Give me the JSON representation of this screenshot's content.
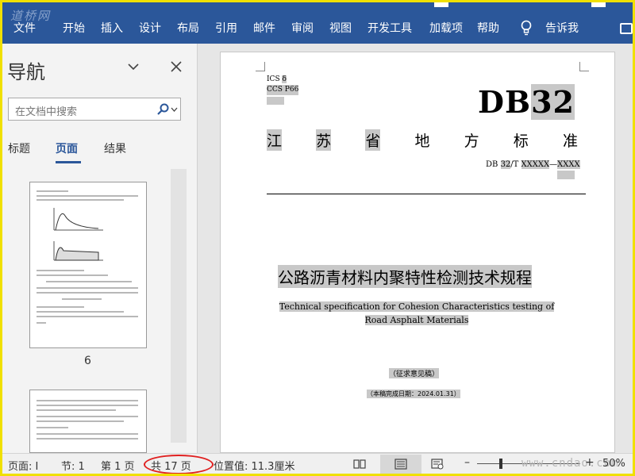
{
  "ribbon": {
    "watermark": "道桥网",
    "tabs": [
      "文件",
      "开始",
      "插入",
      "设计",
      "布局",
      "引用",
      "邮件",
      "审阅",
      "视图",
      "开发工具",
      "加载项",
      "帮助"
    ],
    "tell_me": "告诉我",
    "accent": "#2b579a"
  },
  "nav": {
    "title": "导航",
    "search_placeholder": "在文档中搜索",
    "tabs": [
      "标题",
      "页面",
      "结果"
    ],
    "active_tab": "页面",
    "thumb_page_number": "6"
  },
  "document": {
    "ics": "ICS",
    "ics_no": "δ",
    "ccs": "CCS P66",
    "db_code": "DB",
    "db_num": "32",
    "province_chars": [
      "江",
      "苏",
      "省",
      "地",
      "方",
      "标",
      "准"
    ],
    "std_prefix": "DB",
    "std_num": "32",
    "std_suffix": "/T",
    "std_no1": "XXXXX",
    "std_dash": "—",
    "std_no2": "XXXX",
    "title_cn": "公路沥青材料内聚特性检测技术规程",
    "title_en": "Technical specification for Cohesion Characteristics testing of Road Asphalt Materials",
    "draft_note": "（征求意见稿）",
    "completion_date": "（本稿完成日期：2024.01.31）"
  },
  "status": {
    "page": "页面: I",
    "section": "节: 1",
    "page_num": "第 1 页",
    "total_pages": "共 17 页",
    "position": "位置值: 11.3厘米",
    "zoom_minus": "–",
    "zoom_plus": "+",
    "zoom": "50%",
    "site_watermark": "www.cndao.com",
    "highlight_color": "#e02020"
  }
}
